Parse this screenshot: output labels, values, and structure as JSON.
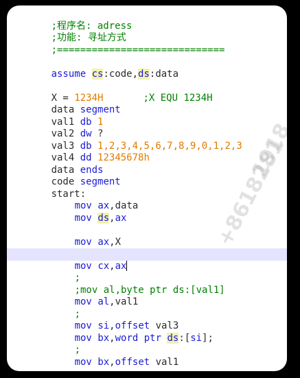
{
  "lines": [
    {
      "id": "comment-program-name",
      "text": ";程序名: adress"
    },
    {
      "id": "comment-function",
      "text": ";功能: 寻址方式"
    },
    {
      "id": "comment-divider",
      "text": ";============================="
    },
    {
      "id": "blank-1",
      "text": ""
    },
    {
      "id": "assume",
      "kw1": "assume",
      "r1": "cs",
      "t1": ":code,",
      "r2": "ds",
      "t2": ":data"
    },
    {
      "id": "blank-2",
      "text": ""
    },
    {
      "id": "equate",
      "t1": "X = ",
      "n1": "1234H",
      "comment": ";X EQU 1234H"
    },
    {
      "id": "data-segment",
      "t1": "data ",
      "kw1": "segment"
    },
    {
      "id": "val1",
      "t1": "val1 ",
      "kw1": "db",
      "n1": "1"
    },
    {
      "id": "val2",
      "t1": "val2 ",
      "kw1": "dw",
      "t2": "?"
    },
    {
      "id": "val3",
      "t1": "val3 ",
      "kw1": "db",
      "n1": "1,2,3,4,5,6,7,8,9,0,1,2,3"
    },
    {
      "id": "val4",
      "t1": "val4 ",
      "kw1": "dd",
      "n1": "12345678h"
    },
    {
      "id": "data-ends",
      "t1": "data ",
      "kw1": "ends"
    },
    {
      "id": "code-segment",
      "t1": "code ",
      "kw1": "segment"
    },
    {
      "id": "start-label",
      "t1": "start:"
    },
    {
      "id": "mov-ax-data",
      "kw1": "mov",
      "r1": "ax",
      "t1": ",data"
    },
    {
      "id": "mov-ds-ax",
      "kw1": "mov",
      "r1": "ds",
      "t1": ",",
      "r2": "ax"
    },
    {
      "id": "blank-3",
      "text": ""
    },
    {
      "id": "mov-ax-x",
      "kw1": "mov",
      "r1": "ax",
      "t1": ",X"
    },
    {
      "id": "semicolon-1",
      "comment": ";"
    },
    {
      "id": "mov-cx-ax",
      "kw1": "mov",
      "r1": "cx",
      "t1": ",",
      "r2": "ax"
    },
    {
      "id": "semicolon-2",
      "comment": ";"
    },
    {
      "id": "comment-mov-al",
      "comment": ";mov al,byte ptr ds:[val1]"
    },
    {
      "id": "mov-al-val1",
      "kw1": "mov",
      "r1": "al",
      "t1": ",val1"
    },
    {
      "id": "semicolon-3",
      "comment": ";"
    },
    {
      "id": "mov-si-offset",
      "kw1": "mov",
      "r1": "si",
      "t1": ",",
      "kw2": "offset",
      "t2": " val3"
    },
    {
      "id": "mov-bx-word",
      "kw1": "mov",
      "r1": "bx",
      "t1": ",",
      "kw2": "word ptr",
      "t2": " ",
      "r2": "ds",
      "t3": ":[",
      "r3": "si",
      "t4": "];"
    },
    {
      "id": "semicolon-4",
      "comment": ";"
    },
    {
      "id": "mov-bx-offset",
      "kw1": "mov",
      "r1": "bx",
      "t1": ",",
      "kw2": "offset",
      "t2": " val1"
    }
  ],
  "watermark": {
    "line1": "1918",
    "line2": "+8618281"
  },
  "colors": {
    "comment": "#008000",
    "keyword": "#1a1ad6",
    "number": "#e07b00",
    "current_line": "#e4e4ff",
    "match_highlight": "#f2f2b0"
  }
}
